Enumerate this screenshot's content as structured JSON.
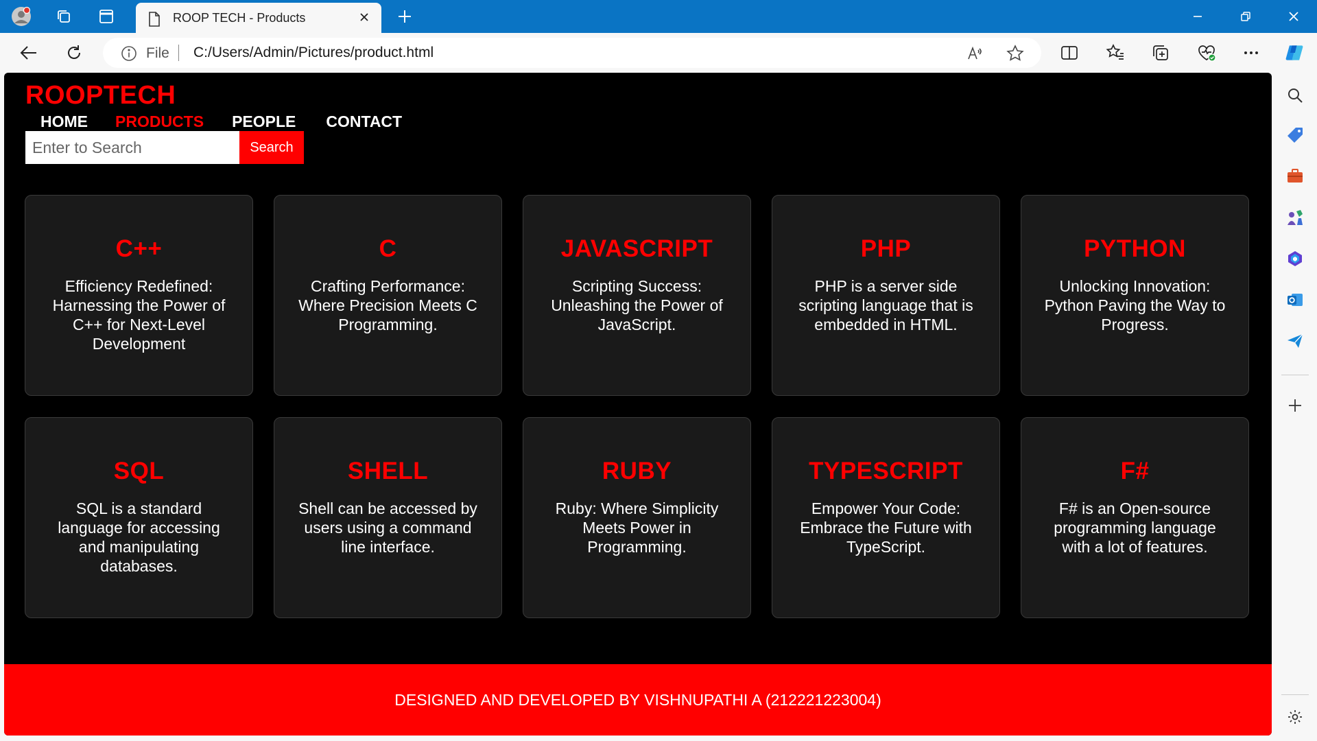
{
  "browser": {
    "tab_title": "ROOP TECH - Products",
    "address_scheme": "File",
    "address_url": "C:/Users/Admin/Pictures/product.html"
  },
  "site": {
    "brand": "ROOPTECH",
    "nav": [
      {
        "label": "HOME",
        "active": false
      },
      {
        "label": "PRODUCTS",
        "active": true
      },
      {
        "label": "PEOPLE",
        "active": false
      },
      {
        "label": "CONTACT",
        "active": false
      }
    ],
    "search": {
      "placeholder": "Enter to Search",
      "button_label": "Search"
    },
    "products": [
      {
        "title": "C++",
        "description": "Efficiency Redefined: Harnessing the Power of C++ for Next-Level Development"
      },
      {
        "title": "C",
        "description": "Crafting Performance: Where Precision Meets C Programming."
      },
      {
        "title": "JAVASCRIPT",
        "description": "Scripting Success: Unleashing the Power of JavaScript."
      },
      {
        "title": "PHP",
        "description": "PHP is a server side scripting language that is embedded in HTML."
      },
      {
        "title": "PYTHON",
        "description": "Unlocking Innovation: Python Paving the Way to Progress."
      },
      {
        "title": "SQL",
        "description": "SQL is a standard language for accessing and manipulating databases."
      },
      {
        "title": "SHELL",
        "description": "Shell can be accessed by users using a command line interface."
      },
      {
        "title": "RUBY",
        "description": "Ruby: Where Simplicity Meets Power in Programming."
      },
      {
        "title": "TYPESCRIPT",
        "description": "Empower Your Code: Embrace the Future with TypeScript."
      },
      {
        "title": "F#",
        "description": "F# is an Open-source programming language with a lot of features."
      }
    ],
    "footer": "DESIGNED AND DEVELOPED BY VISHNUPATHI A (212221223004)"
  },
  "colors": {
    "accent": "#ff0000",
    "card_bg": "#1a1a1a",
    "page_bg": "#000000",
    "chrome_blue": "#0a74c4"
  }
}
